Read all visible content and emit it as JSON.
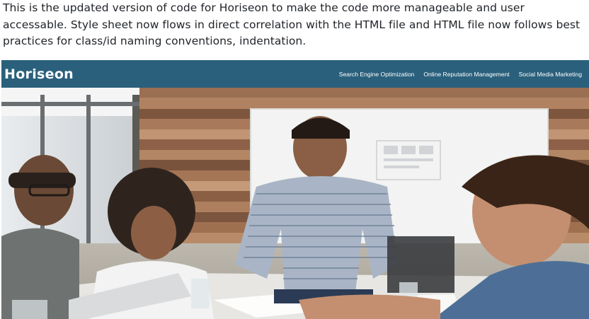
{
  "readme": {
    "paragraph": "This is the updated version of code for Horiseon to make the code more manageable and user accessable. Style sheet now flows in direct correlation with the HTML file and HTML file now follows best practices for class/id naming conventions, indentation."
  },
  "site": {
    "logo": "Horiseon",
    "nav": [
      {
        "label": "Search Engine Optimization"
      },
      {
        "label": "Online Reputation Management"
      },
      {
        "label": "Social Media Marketing"
      }
    ],
    "colors": {
      "header_bg": "#2a607c",
      "header_text": "#ffffff"
    }
  },
  "hero": {
    "image": "team-meeting-photo"
  }
}
